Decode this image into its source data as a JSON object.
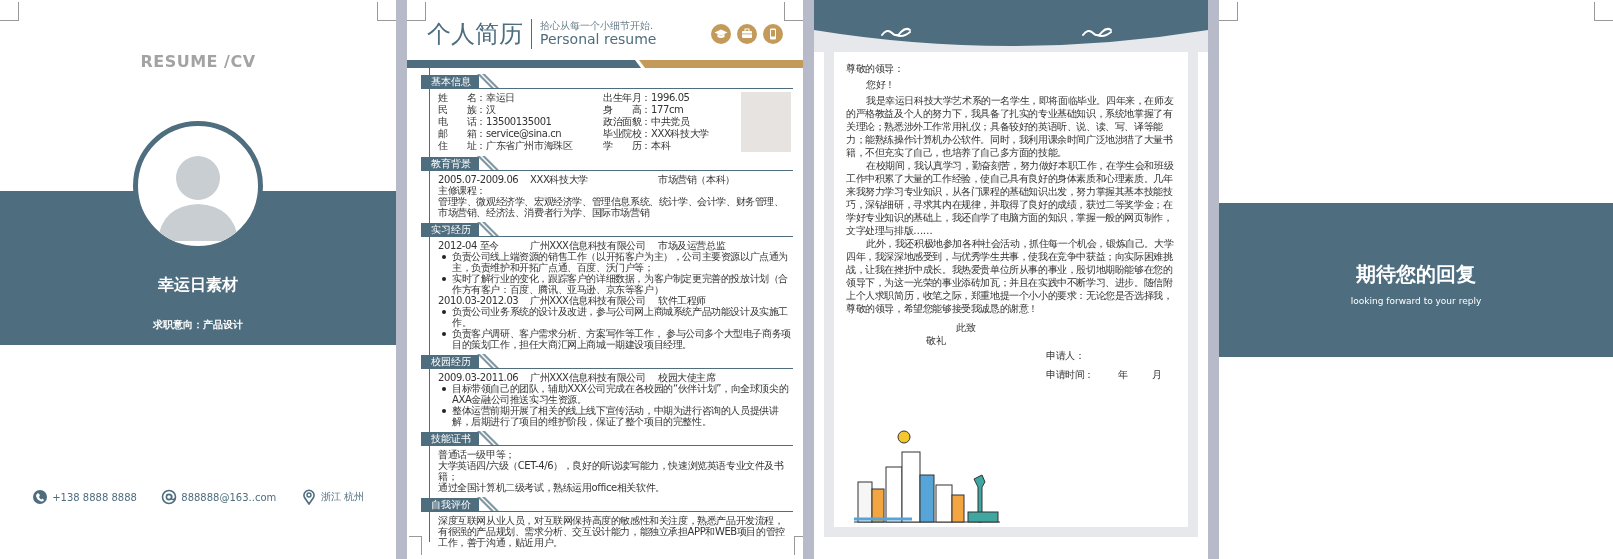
{
  "cover": {
    "title": "RESUME /CV",
    "name": "幸运日素材",
    "objective": "求职意向：产品设计",
    "contacts": [
      {
        "kind": "phone",
        "text": "+138 8888 8888"
      },
      {
        "kind": "email",
        "text": "888888@163..com"
      },
      {
        "kind": "location",
        "text": "浙江  杭州"
      }
    ]
  },
  "resume": {
    "title": "个人简历",
    "slogan": "拾心从每一个小细节开始.",
    "subtitle": "Personal resume",
    "sections": [
      {
        "title": "基本信息",
        "kind": "info",
        "left": [
          "姓　　名：幸运日",
          "民　　族：汉",
          "电　　话：13500135001",
          "邮　　箱：service@sina.cn",
          "住　　址：广东省广州市海珠区"
        ],
        "right": [
          "出生年月：1996.05",
          "身　　高：177cm",
          "政治面貌：中共党员",
          "毕业院校：XXX科技大学",
          "学　　历：本科"
        ]
      },
      {
        "title": "教育背景",
        "kind": "entries",
        "entries": [
          {
            "date": "2005.07-2009.06",
            "org": "XXX科技大学",
            "role": "市场营销（本科）",
            "notes": [
              "主修课程：",
              "管理学、微观经济学、宏观经济学、管理信息系统、统计学、会计学、财务管理、市场营销、经济法、消费者行为学、国际市场营销"
            ]
          }
        ]
      },
      {
        "title": "实习经历",
        "kind": "entries",
        "entries": [
          {
            "date": "2012-04 至今",
            "org": "广州XXX信息科技有限公司",
            "role": "市场及运营总监",
            "bullets": [
              "负责公司线上端资源的销售工作（以开拓客户为主），公司主要资源以广点通为主，负责维护和开拓广点通、百度、沃门户等；",
              "实时了解行业的变化，跟踪客户的详细数据，为客户制定更完善的投放计划（合作方有客户：百度、腾讯、亚马逊、京东等客户）"
            ]
          },
          {
            "date": "2010.03-2012.03",
            "org": "广州XXX信息科技有限公司",
            "role": "软件工程师",
            "bullets": [
              "负责公司业务系统的设计及改进，参与公司网上商城系统产品功能设计及实施工作。",
              "负责客户调研、客户需求分析、方案写作等工作， 参与公司多个大型电子商务项目的策划工作，担任大商汇网上商城一期建设项目经理。"
            ]
          }
        ]
      },
      {
        "title": "校园经历",
        "kind": "entries",
        "entries": [
          {
            "date": "2009.03-2011.06",
            "org": "广州XXX信息科技有限公司",
            "role": "校园大使主席",
            "bullets": [
              "目标带领自己的团队，辅助XXX公司完成在各校园的“伙伴计划”，向全球顶尖的AXA金融公司推送实习生资源。",
              "整体运营前期开展了相关的线上线下宣传活动，中期为进行咨询的人员提供讲解，后期进行了项目的维护阶段，保证了整个项目的完整性。"
            ]
          }
        ]
      },
      {
        "title": "技能证书",
        "kind": "lines",
        "lines": [
          "普通话一级甲等；",
          "大学英语四/六级（CET-4/6），良好的听说读写能力，快速浏览英语专业文件及书籍；",
          "通过全国计算机二级考试，熟练运用office相关软件。"
        ]
      },
      {
        "title": "自我评价",
        "kind": "paragraph",
        "text": "深度互联网从业人员，对互联网保持高度的敏感性和关注度，熟悉产品开发流程，有很强的产品规划、需求分析、交互设计能力，能独立承担APP和WEB项目的管控工作，善于沟通，贴近用户。"
      }
    ]
  },
  "letter": {
    "greeting": "尊敬的领导：",
    "salutation": "您好！",
    "paragraphs": [
      "我是幸运日科技大学艺术系的一名学生，即将面临毕业。四年来，在师友的严格教益及个人的努力下，我具备了扎实的专业基础知识，系统地掌握了有关理论；熟悉涉外工作常用礼仪；具备较好的英语听、说、读、写、译等能力；能熟练操作计算机办公软件。同时，我利用课余时间广泛地涉猎了大量书籍，不但充实了自己，也培养了自己多方面的技能。",
      "在校期间，我认真学习，勤奋刻苦，努力做好本职工作，在学生会和班级工作中积累了大量的工作经验，使自己具有良好的身体素质和心理素质。几年来我努力学习专业知识，从各门课程的基础知识出发，努力掌握其基本技能技巧，深钻细研，寻求其内在规律，并取得了良好的成绩，获过二等奖学金；在学好专业知识的基础上，我还自学了电脑方面的知识，掌握一般的网页制作，文字处理与排版……",
      "此外，我还积极地参加各种社会活动，抓住每一个机会，锻炼自己。大学四年，我深深地感受到，与优秀学生共事，使我在竞争中获益；向实际困难挑战，让我在挫折中成长。我热爱贵单位所从事的事业，殷切地期盼能够在您的领导下，为这一光荣的事业添砖加瓦；并且在实践中不断学习、进步。随信附上个人求职简历，收笔之际，郑重地提一个小小的要求：无论您是否选择我，尊敬的领导，希望您能够接受我诚恳的谢意！"
    ],
    "closing": "此致",
    "regards": "敬礼",
    "signature_label": "申请人：",
    "date_label": "申请时间：",
    "year": "年",
    "month": "月"
  },
  "back": {
    "title": "期待您的回复",
    "subtitle": "looking forward to your reply"
  }
}
